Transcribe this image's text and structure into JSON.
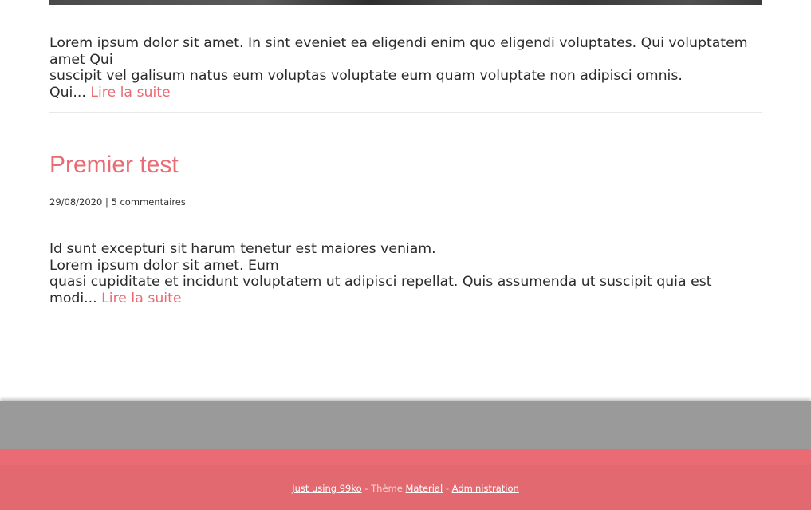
{
  "posts": [
    {
      "excerpt_line1": "Lorem ipsum dolor sit amet. In sint eveniet ea eligendi enim quo eligendi voluptates. Qui voluptatem amet Qui",
      "excerpt_line2": "suscipit vel galisum natus eum voluptas voluptate eum quam voluptate non adipisci omnis.",
      "excerpt_line3": "Qui... ",
      "read_more": "Lire la suite"
    },
    {
      "title": "Premier test",
      "date": "29/08/2020",
      "separator": " | ",
      "comments": "5 commentaires",
      "excerpt_line1": "Id sunt excepturi sit harum tenetur est maiores veniam.",
      "excerpt_line2": "Lorem ipsum dolor sit amet. Eum",
      "excerpt_line3": "quasi cupiditate et incidunt voluptatem ut adipisci repellat. Quis assumenda ut suscipit quia est modi... ",
      "read_more": "Lire la suite"
    }
  ],
  "footer": {
    "powered_link": "Just using 99ko",
    "theme_prefix": " - Thème ",
    "theme_link": "Material",
    "dash": " - ",
    "admin_link": "Administration"
  },
  "colors": {
    "accent": "#e96b73",
    "footer_bg": "#e2696f",
    "gray_band": "#9a9a9a"
  }
}
